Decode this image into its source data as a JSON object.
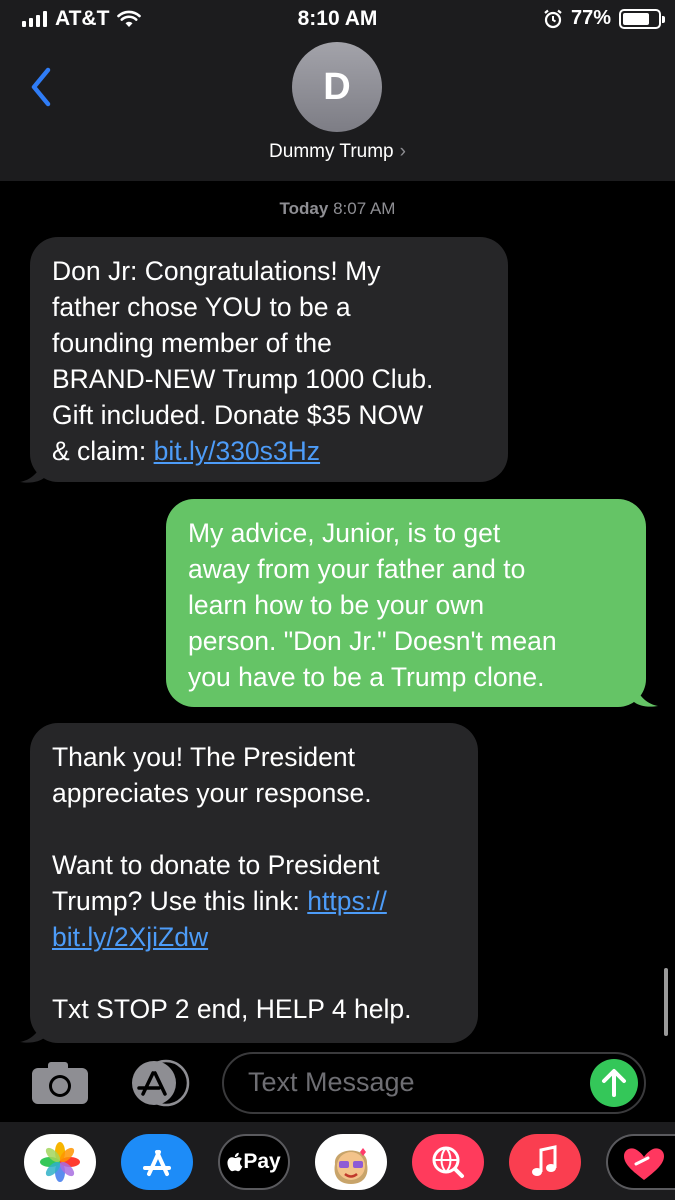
{
  "status_bar": {
    "carrier": "AT&T",
    "time": "8:10 AM",
    "battery": "77%",
    "battery_level": 0.77
  },
  "header": {
    "avatar_initial": "D",
    "contact_name": "Dummy Trump",
    "chevron": "›"
  },
  "conversation": {
    "timestamp_day": "Today",
    "timestamp_time": "8:07 AM",
    "messages": [
      {
        "direction": "incoming",
        "text": "Don Jr: Congratulations! My\nfather chose YOU to be a\nfounding member of the\nBRAND-NEW Trump 1000 Club.\nGift included. Donate $35 NOW\n& claim: ",
        "link": "bit.ly/330s3Hz"
      },
      {
        "direction": "outgoing",
        "text": "My advice, Junior, is to get\naway from your father and to\nlearn how to be your own\nperson. \"Don Jr.\" Doesn't mean\nyou have to be a Trump clone."
      },
      {
        "direction": "incoming",
        "text_before": "Thank you! The President\nappreciates your response.\n\nWant to donate to President\nTrump? Use this link: ",
        "link": "https://\nbit.ly/2XjiZdw",
        "text_after": "\n\nTxt STOP 2 end, HELP 4 help."
      }
    ]
  },
  "composer": {
    "placeholder": "Text Message",
    "camera_icon": "camera-icon",
    "apps_icon": "app-store-icon",
    "send_icon": "arrow-up-icon"
  },
  "app_drawer": {
    "apps": [
      "photos",
      "app-store",
      "apple-pay",
      "memoji",
      "images-search",
      "music",
      "digital-touch"
    ],
    "apple_pay_label": "Pay"
  },
  "colors": {
    "incoming_bubble": "#262628",
    "outgoing_bubble": "#65c466",
    "link": "#4d9cf8",
    "accent_blue": "#2f7cf6",
    "send_green": "#34c759"
  }
}
